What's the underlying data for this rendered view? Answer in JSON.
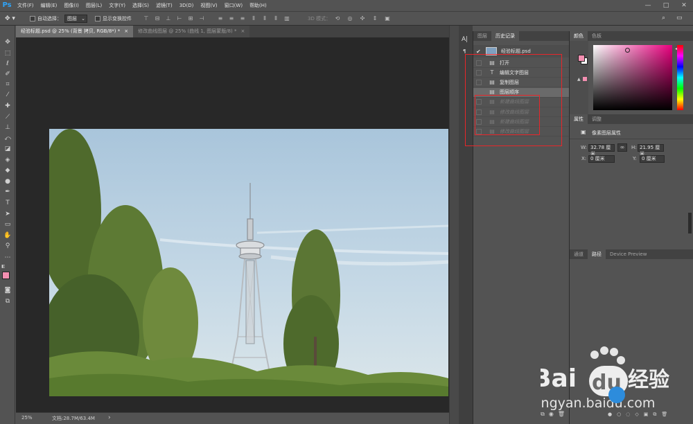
{
  "app": {
    "logo": "Ps"
  },
  "menu": [
    "文件(F)",
    "编辑(E)",
    "图像(I)",
    "图层(L)",
    "文字(Y)",
    "选择(S)",
    "滤镜(T)",
    "3D(D)",
    "视图(V)",
    "窗口(W)",
    "帮助(H)"
  ],
  "window_controls": {
    "minimize": "—",
    "maximize": "□",
    "close": "✕"
  },
  "options_bar": {
    "auto_select_label": "自动选择：",
    "auto_select_value": "图层",
    "show_transform_label": "显示变换控件",
    "mode_3d_label": "3D 模式："
  },
  "document_tabs": [
    {
      "label": "经验标题.psd @ 25% (背景 拷贝, RGB/8*) *",
      "close": "×",
      "active": true
    },
    {
      "label": "修改曲线图层 @ 25% (曲线 1, 图层蒙版/8) *",
      "close": "×",
      "active": false
    }
  ],
  "status_bar": {
    "zoom": "25%",
    "doc_info": "文档:28.7M/63.4M",
    "arrow": "›"
  },
  "history_panel": {
    "tabs": [
      {
        "label": "图层",
        "active": false
      },
      {
        "label": "历史记录",
        "active": true
      }
    ],
    "snapshot": {
      "label": "经验标题.psd"
    },
    "states": [
      {
        "label": "打开",
        "icon": "document-icon",
        "selected": false,
        "dim": false
      },
      {
        "label": "编辑文字图层",
        "icon": "text-icon",
        "selected": false,
        "dim": false
      },
      {
        "label": "复制图层",
        "icon": "document-icon",
        "selected": false,
        "dim": false
      },
      {
        "label": "图层顺序",
        "icon": "document-icon",
        "selected": true,
        "dim": false
      },
      {
        "label": "新建曲线图层",
        "icon": "document-icon",
        "selected": false,
        "dim": true
      },
      {
        "label": "修改曲线图层",
        "icon": "document-icon",
        "selected": false,
        "dim": true
      },
      {
        "label": "新建曲线图层",
        "icon": "document-icon",
        "selected": false,
        "dim": true
      },
      {
        "label": "修改曲线图层",
        "icon": "document-icon",
        "selected": false,
        "dim": true
      }
    ]
  },
  "color_panel": {
    "tabs": [
      {
        "label": "颜色",
        "active": true
      },
      {
        "label": "色板",
        "active": false
      }
    ],
    "foreground": "#f48fb1",
    "background": "#ffffff"
  },
  "properties_panel": {
    "tabs": [
      {
        "label": "属性",
        "active": true
      },
      {
        "label": "调整",
        "active": false
      }
    ],
    "title": "像素图层属性",
    "w_label": "W:",
    "w_value": "32.78 厘米",
    "h_label": "H:",
    "h_value": "21.95 厘米",
    "x_label": "X:",
    "x_value": "0 厘米",
    "y_label": "Y:",
    "y_value": "0 厘米"
  },
  "paths_panel": {
    "tabs": [
      {
        "label": "通道",
        "active": false
      },
      {
        "label": "路径",
        "active": true
      },
      {
        "label": "Device Preview",
        "active": false
      }
    ]
  },
  "collapsed_panel": {
    "label": "A|"
  },
  "watermark": {
    "brand": "Bai",
    "brand2": "经验",
    "du": "du",
    "url": "jingyan.baidu.com"
  },
  "colors": {
    "highlight": "#e8262a",
    "ps_blue": "#2fa3f6"
  }
}
